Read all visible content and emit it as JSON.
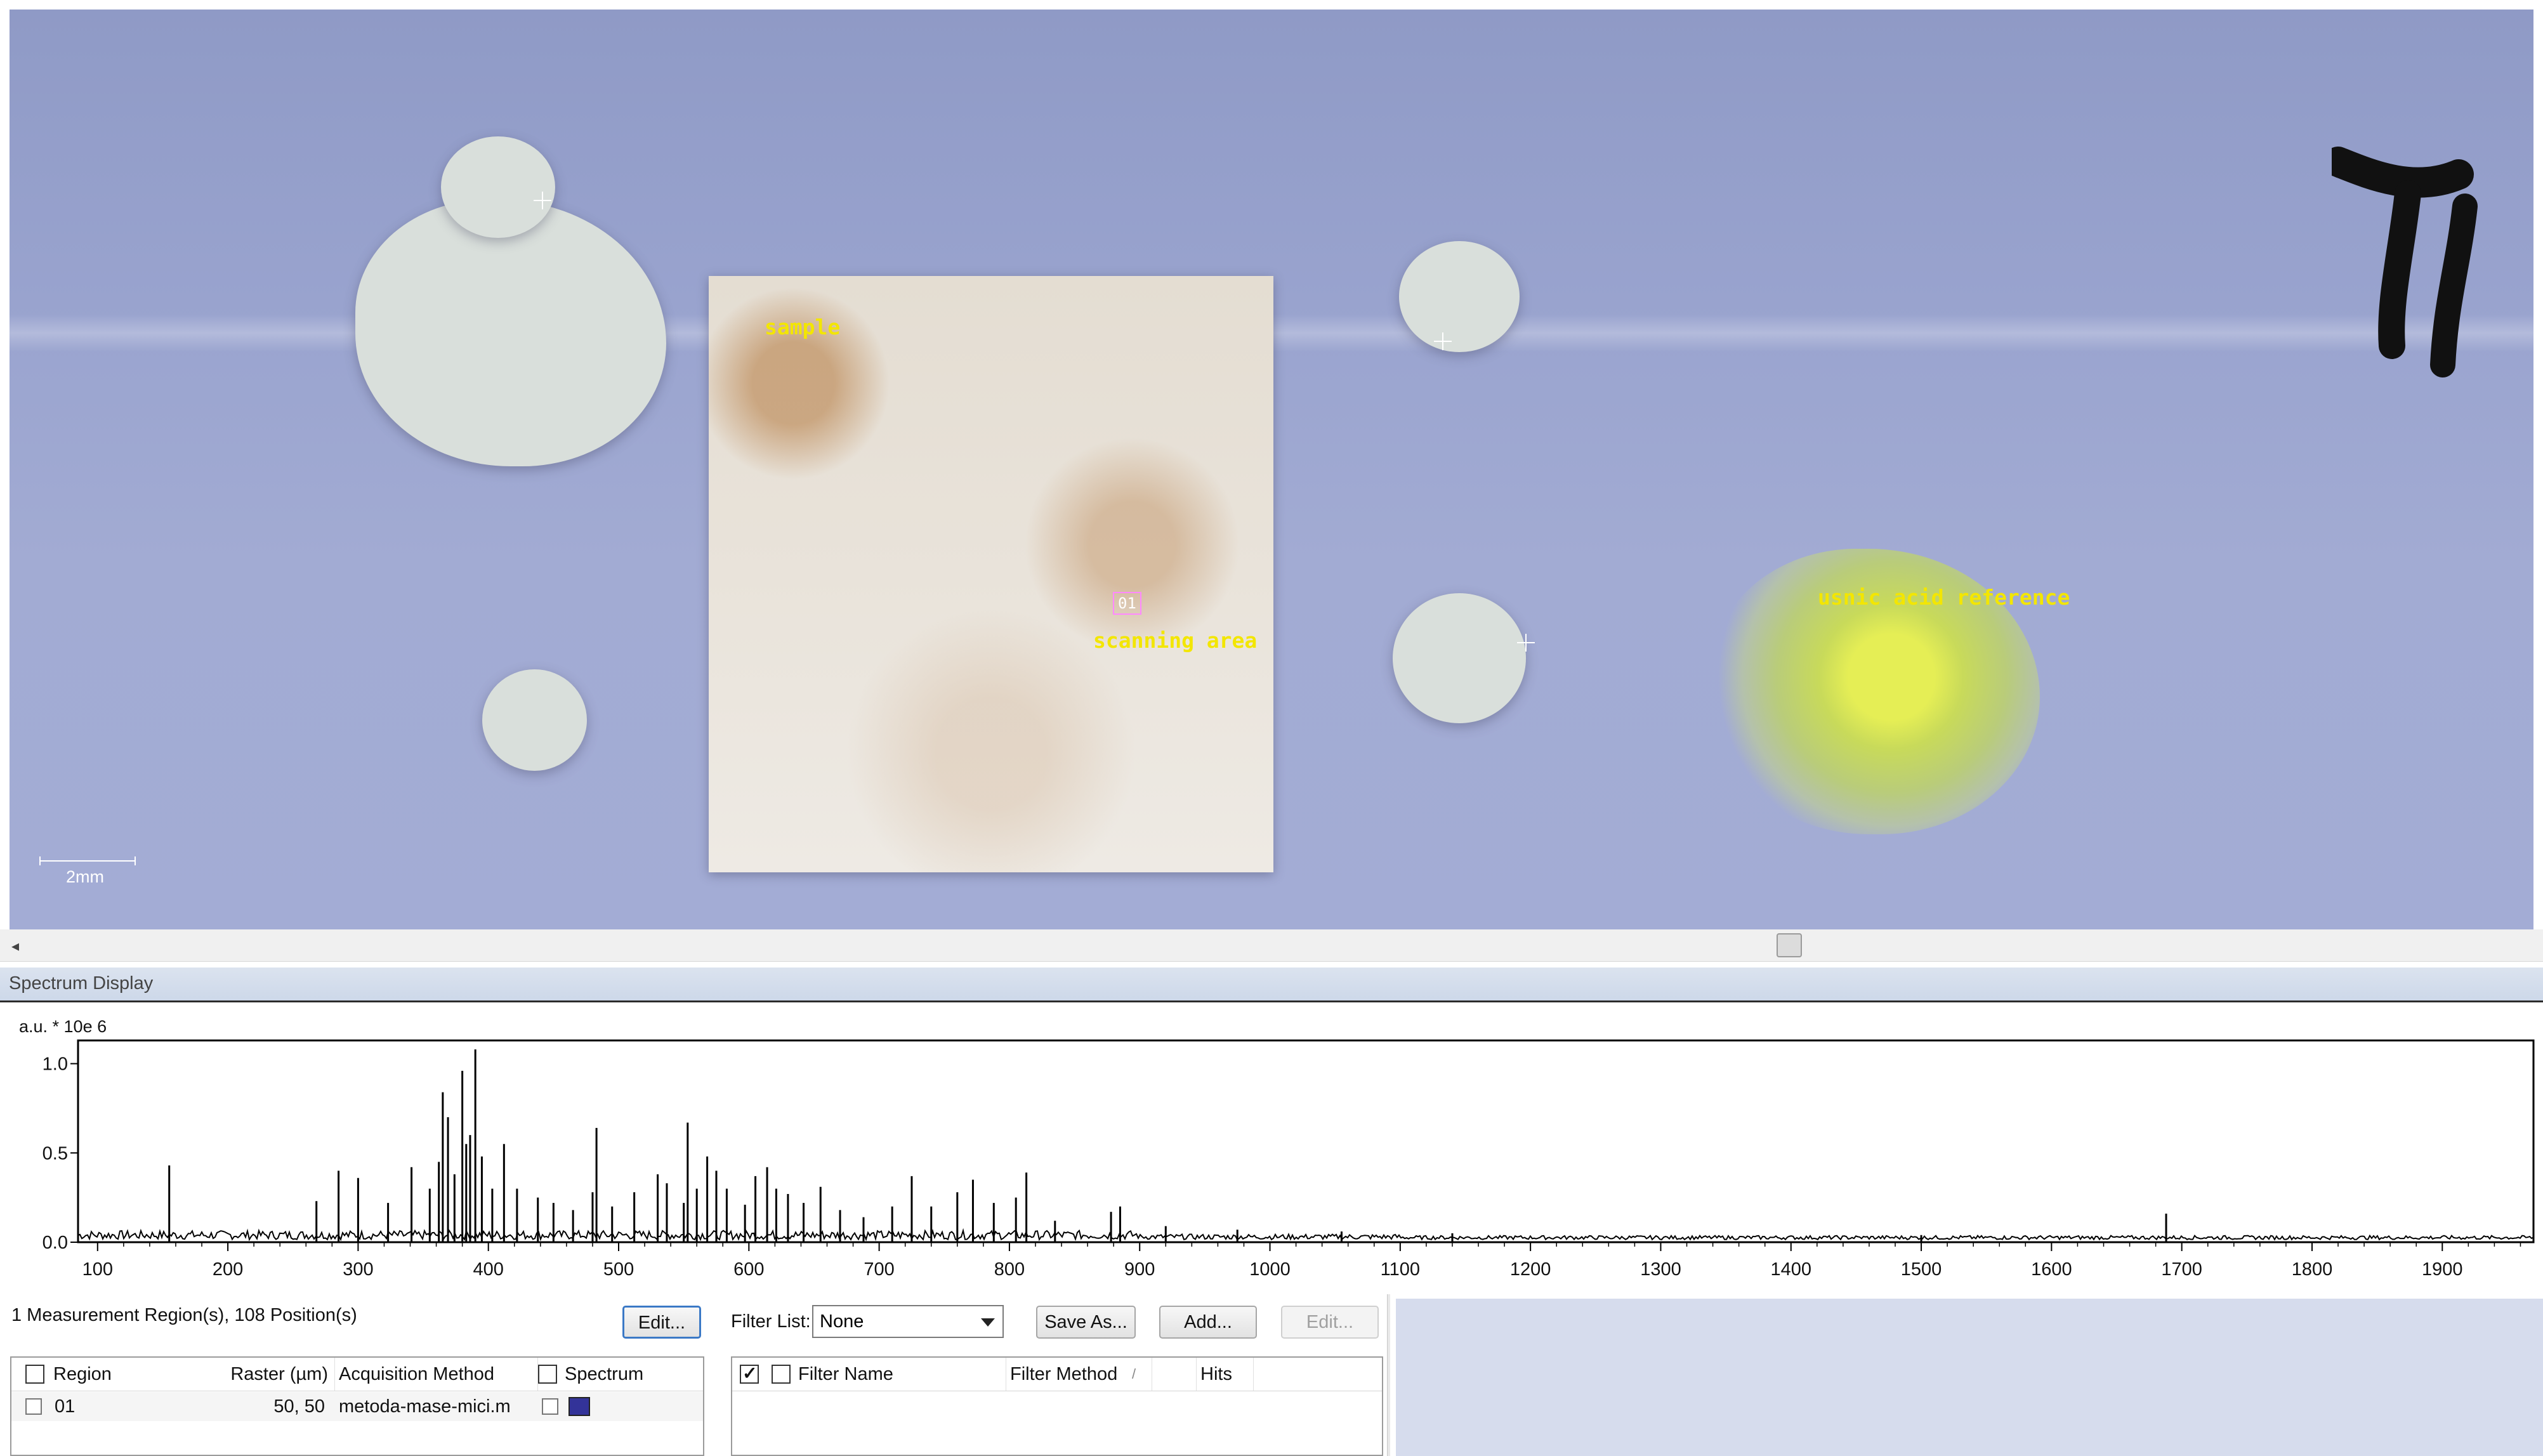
{
  "image_view": {
    "labels": {
      "sample": "sample",
      "scanning_area": "scanning area",
      "reference": "usnic acid reference"
    },
    "region_marker": "01",
    "scale_bar": "2mm",
    "label_color": "#f3e600"
  },
  "scrollbar": {
    "left_arrow": "◂"
  },
  "spectrum_panel": {
    "title": "Spectrum Display",
    "y_unit": "a.u. * 10e 6"
  },
  "chart_data": {
    "type": "line",
    "title": "",
    "xlabel": "",
    "ylabel": "a.u. * 10e 6",
    "xlim": [
      85,
      1970
    ],
    "ylim": [
      0,
      1.13
    ],
    "x_ticks": [
      100,
      200,
      300,
      400,
      500,
      600,
      700,
      800,
      900,
      1000,
      1100,
      1200,
      1300,
      1400,
      1500,
      1600,
      1700,
      1800,
      1900
    ],
    "y_ticks": [
      0.0,
      0.5,
      1.0
    ],
    "y_tick_labels": [
      "0.0",
      "0.5",
      "1.0"
    ],
    "color": "#000000",
    "baseline": 0.015,
    "peaks": [
      {
        "x": 155,
        "y": 0.43
      },
      {
        "x": 268,
        "y": 0.23
      },
      {
        "x": 285,
        "y": 0.4
      },
      {
        "x": 300,
        "y": 0.36
      },
      {
        "x": 323,
        "y": 0.22
      },
      {
        "x": 341,
        "y": 0.42
      },
      {
        "x": 355,
        "y": 0.3
      },
      {
        "x": 362,
        "y": 0.45
      },
      {
        "x": 365,
        "y": 0.84
      },
      {
        "x": 369,
        "y": 0.7
      },
      {
        "x": 374,
        "y": 0.38
      },
      {
        "x": 380,
        "y": 0.96
      },
      {
        "x": 383,
        "y": 0.55
      },
      {
        "x": 386,
        "y": 0.6
      },
      {
        "x": 390,
        "y": 1.08
      },
      {
        "x": 395,
        "y": 0.48
      },
      {
        "x": 403,
        "y": 0.3
      },
      {
        "x": 412,
        "y": 0.55
      },
      {
        "x": 422,
        "y": 0.3
      },
      {
        "x": 438,
        "y": 0.25
      },
      {
        "x": 450,
        "y": 0.22
      },
      {
        "x": 465,
        "y": 0.18
      },
      {
        "x": 480,
        "y": 0.28
      },
      {
        "x": 483,
        "y": 0.64
      },
      {
        "x": 495,
        "y": 0.2
      },
      {
        "x": 512,
        "y": 0.28
      },
      {
        "x": 530,
        "y": 0.38
      },
      {
        "x": 537,
        "y": 0.33
      },
      {
        "x": 550,
        "y": 0.22
      },
      {
        "x": 553,
        "y": 0.67
      },
      {
        "x": 560,
        "y": 0.3
      },
      {
        "x": 568,
        "y": 0.48
      },
      {
        "x": 575,
        "y": 0.4
      },
      {
        "x": 583,
        "y": 0.3
      },
      {
        "x": 597,
        "y": 0.21
      },
      {
        "x": 605,
        "y": 0.37
      },
      {
        "x": 614,
        "y": 0.42
      },
      {
        "x": 621,
        "y": 0.3
      },
      {
        "x": 630,
        "y": 0.27
      },
      {
        "x": 642,
        "y": 0.22
      },
      {
        "x": 655,
        "y": 0.31
      },
      {
        "x": 670,
        "y": 0.18
      },
      {
        "x": 688,
        "y": 0.14
      },
      {
        "x": 710,
        "y": 0.2
      },
      {
        "x": 725,
        "y": 0.37
      },
      {
        "x": 740,
        "y": 0.2
      },
      {
        "x": 760,
        "y": 0.28
      },
      {
        "x": 772,
        "y": 0.35
      },
      {
        "x": 788,
        "y": 0.22
      },
      {
        "x": 805,
        "y": 0.25
      },
      {
        "x": 813,
        "y": 0.39
      },
      {
        "x": 835,
        "y": 0.12
      },
      {
        "x": 878,
        "y": 0.17
      },
      {
        "x": 885,
        "y": 0.2
      },
      {
        "x": 920,
        "y": 0.09
      },
      {
        "x": 975,
        "y": 0.07
      },
      {
        "x": 1055,
        "y": 0.06
      },
      {
        "x": 1140,
        "y": 0.05
      },
      {
        "x": 1500,
        "y": 0.04
      },
      {
        "x": 1688,
        "y": 0.16
      }
    ]
  },
  "regions": {
    "summary": "1 Measurement Region(s), 108 Position(s)",
    "edit_label": "Edit...",
    "columns": [
      "Region",
      "Raster (µm)",
      "Acquisition Method",
      "Spectrum"
    ],
    "rows": [
      {
        "region": "01",
        "raster": "50, 50",
        "method": "metoda-mase-mici.m",
        "spectrum_color": "#333399"
      }
    ]
  },
  "filters": {
    "label": "Filter List:",
    "selected": "None",
    "save_as_label": "Save As...",
    "add_label": "Add...",
    "edit_label": "Edit...",
    "columns": [
      "Filter Name",
      "Filter Method",
      "Hits"
    ],
    "sort_glyph": "/"
  },
  "colors": {
    "header_bg": "#cdd8e9",
    "right_pane_bg": "#d6dced",
    "focus_border": "#3b79c6"
  }
}
